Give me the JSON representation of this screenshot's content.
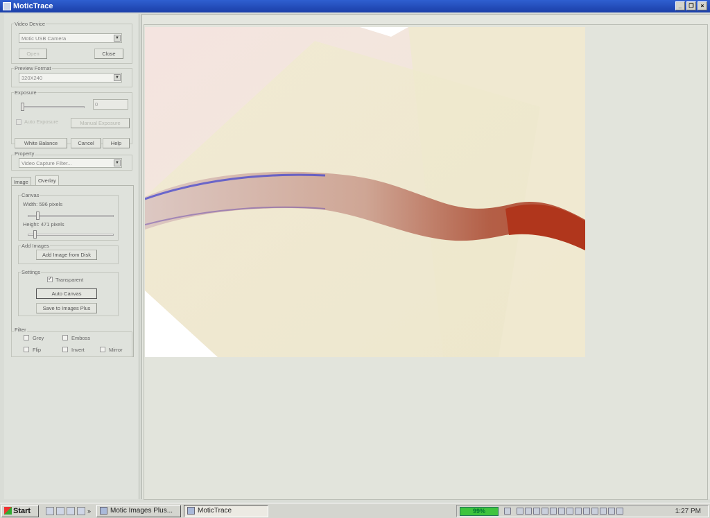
{
  "window": {
    "title": "MoticTrace",
    "controls": {
      "minimize": "_",
      "restore": "❐",
      "close": "×"
    }
  },
  "video_device": {
    "group_label": "Video Device",
    "device_value": "Motic USB Camera",
    "open_label": "Open",
    "close_label": "Close"
  },
  "preview_format": {
    "group_label": "Preview Format",
    "value": "320X240"
  },
  "exposure": {
    "group_label": "Exposure",
    "value": "0",
    "slider_level": 0,
    "auto_label": "Auto Exposure",
    "auto_checked": false,
    "manual_label": "Manual Exposure"
  },
  "actions": {
    "white_balance": "White Balance",
    "cancel": "Cancel",
    "help": "Help"
  },
  "property": {
    "group_label": "Property",
    "value": "Video Capture Filter..."
  },
  "tabs": [
    {
      "label": "Image",
      "active": false
    },
    {
      "label": "Overlay",
      "active": true
    }
  ],
  "canvas": {
    "group_label": "Canvas",
    "width_label": "Width: 596 pixels",
    "height_label": "Height: 471 pixels"
  },
  "add_images": {
    "group_label": "Add Images",
    "button": "Add Image from Disk"
  },
  "settings": {
    "group_label": "Settings",
    "transparent_label": "Transparent",
    "transparent_checked": true,
    "auto_canvas": "Auto Canvas",
    "save_button": "Save to Images Plus"
  },
  "filter": {
    "group_label": "Filter",
    "grey": "Grey",
    "emboss": "Emboss",
    "flip": "Flip",
    "invert": "Invert",
    "mirror": "Mirror"
  },
  "taskbar": {
    "start": "Start",
    "more": "»",
    "tasks": [
      {
        "label": "Motic Images Plus...",
        "active": false
      },
      {
        "label": "MoticTrace",
        "active": true
      }
    ],
    "zoom": "99%",
    "clock": "1:27 PM"
  },
  "colors": {
    "titlebar": "#1b3fa8",
    "specimen_red": "#b0361c",
    "zoom_indicator": "#3ec43e"
  }
}
